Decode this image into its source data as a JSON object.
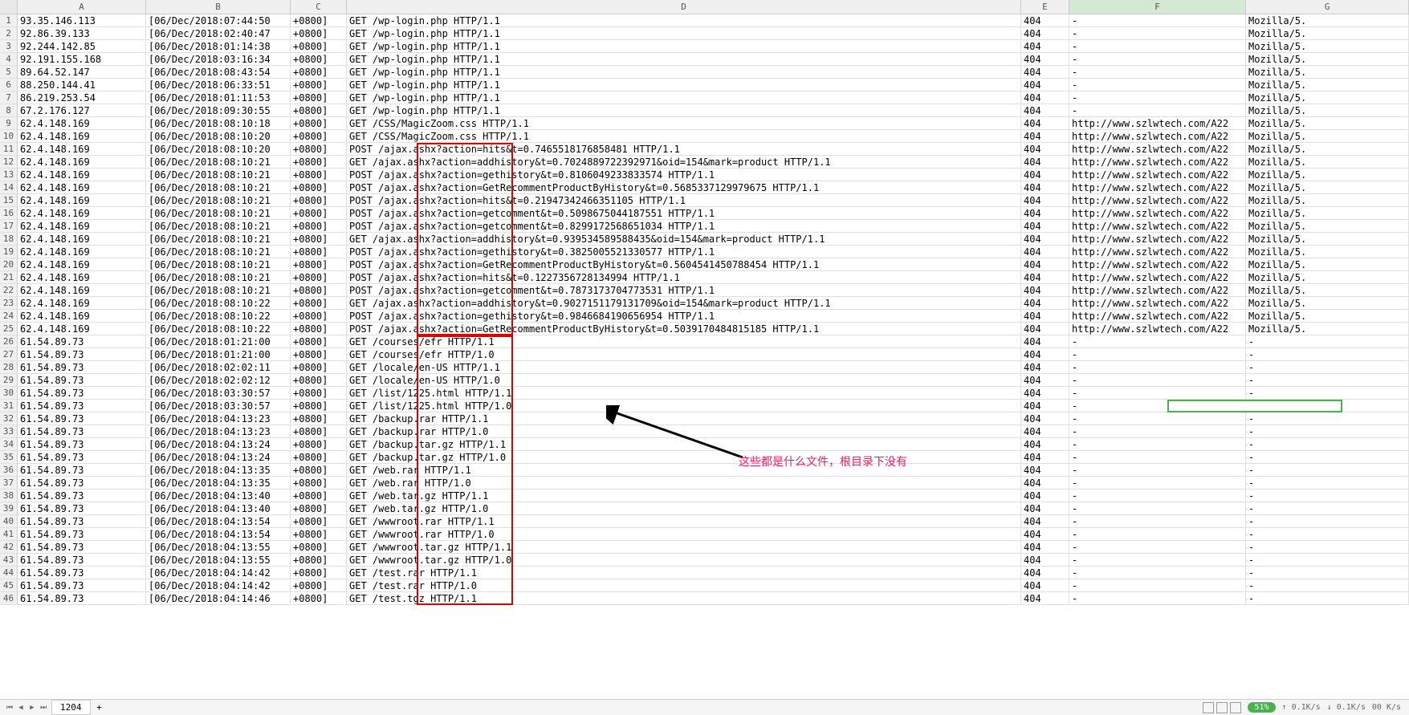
{
  "columns": [
    "A",
    "B",
    "C",
    "D",
    "E",
    "F",
    "G"
  ],
  "active_cell": {
    "row": 31,
    "col": "F"
  },
  "annotation_text": "这些都是什么文件，根目录下没有",
  "sheet_tab": "1204",
  "zoom": "51%",
  "net_up": "0.1K/s",
  "net_down": "0.1K/s",
  "net_total": "00 K/s",
  "rows": [
    {
      "n": 1,
      "A": "93.35.146.113",
      "B": "[06/Dec/2018:07:44:50",
      "C": "+0800]",
      "D": "GET /wp-login.php HTTP/1.1",
      "E": "404",
      "F": "-",
      "G": "Mozilla/5."
    },
    {
      "n": 2,
      "A": "92.86.39.133",
      "B": "[06/Dec/2018:02:40:47",
      "C": "+0800]",
      "D": "GET /wp-login.php HTTP/1.1",
      "E": "404",
      "F": "-",
      "G": "Mozilla/5."
    },
    {
      "n": 3,
      "A": "92.244.142.85",
      "B": "[06/Dec/2018:01:14:38",
      "C": "+0800]",
      "D": "GET /wp-login.php HTTP/1.1",
      "E": "404",
      "F": "-",
      "G": "Mozilla/5."
    },
    {
      "n": 4,
      "A": "92.191.155.168",
      "B": "[06/Dec/2018:03:16:34",
      "C": "+0800]",
      "D": "GET /wp-login.php HTTP/1.1",
      "E": "404",
      "F": "-",
      "G": "Mozilla/5."
    },
    {
      "n": 5,
      "A": "89.64.52.147",
      "B": "[06/Dec/2018:08:43:54",
      "C": "+0800]",
      "D": "GET /wp-login.php HTTP/1.1",
      "E": "404",
      "F": "-",
      "G": "Mozilla/5."
    },
    {
      "n": 6,
      "A": "88.250.144.41",
      "B": "[06/Dec/2018:06:33:51",
      "C": "+0800]",
      "D": "GET /wp-login.php HTTP/1.1",
      "E": "404",
      "F": "-",
      "G": "Mozilla/5."
    },
    {
      "n": 7,
      "A": "86.219.253.54",
      "B": "[06/Dec/2018:01:11:53",
      "C": "+0800]",
      "D": "GET /wp-login.php HTTP/1.1",
      "E": "404",
      "F": "-",
      "G": "Mozilla/5."
    },
    {
      "n": 8,
      "A": "67.2.176.127",
      "B": "[06/Dec/2018:09:30:55",
      "C": "+0800]",
      "D": "GET /wp-login.php HTTP/1.1",
      "E": "404",
      "F": "-",
      "G": "Mozilla/5."
    },
    {
      "n": 9,
      "A": "62.4.148.169",
      "B": "[06/Dec/2018:08:10:18",
      "C": "+0800]",
      "D": "GET /CSS/MagicZoom.css HTTP/1.1",
      "E": "404",
      "F": "http://www.szlwtech.com/A22",
      "G": "Mozilla/5."
    },
    {
      "n": 10,
      "A": "62.4.148.169",
      "B": "[06/Dec/2018:08:10:20",
      "C": "+0800]",
      "D": "GET /CSS/MagicZoom.css HTTP/1.1",
      "E": "404",
      "F": "http://www.szlwtech.com/A22",
      "G": "Mozilla/5."
    },
    {
      "n": 11,
      "A": "62.4.148.169",
      "B": "[06/Dec/2018:08:10:20",
      "C": "+0800]",
      "D": "POST /ajax.ashx?action=hits&t=0.7465518176858481 HTTP/1.1",
      "E": "404",
      "F": "http://www.szlwtech.com/A22",
      "G": "Mozilla/5."
    },
    {
      "n": 12,
      "A": "62.4.148.169",
      "B": "[06/Dec/2018:08:10:21",
      "C": "+0800]",
      "D": "GET /ajax.ashx?action=addhistory&t=0.7024889722392971&oid=154&mark=product HTTP/1.1",
      "E": "404",
      "F": "http://www.szlwtech.com/A22",
      "G": "Mozilla/5."
    },
    {
      "n": 13,
      "A": "62.4.148.169",
      "B": "[06/Dec/2018:08:10:21",
      "C": "+0800]",
      "D": "POST /ajax.ashx?action=gethistory&t=0.8106049233833574 HTTP/1.1",
      "E": "404",
      "F": "http://www.szlwtech.com/A22",
      "G": "Mozilla/5."
    },
    {
      "n": 14,
      "A": "62.4.148.169",
      "B": "[06/Dec/2018:08:10:21",
      "C": "+0800]",
      "D": "POST /ajax.ashx?action=GetRecommentProductByHistory&t=0.5685337129979675 HTTP/1.1",
      "E": "404",
      "F": "http://www.szlwtech.com/A22",
      "G": "Mozilla/5."
    },
    {
      "n": 15,
      "A": "62.4.148.169",
      "B": "[06/Dec/2018:08:10:21",
      "C": "+0800]",
      "D": "POST /ajax.ashx?action=hits&t=0.21947342466351105 HTTP/1.1",
      "E": "404",
      "F": "http://www.szlwtech.com/A22",
      "G": "Mozilla/5."
    },
    {
      "n": 16,
      "A": "62.4.148.169",
      "B": "[06/Dec/2018:08:10:21",
      "C": "+0800]",
      "D": "POST /ajax.ashx?action=getcomment&t=0.5098675044187551 HTTP/1.1",
      "E": "404",
      "F": "http://www.szlwtech.com/A22",
      "G": "Mozilla/5."
    },
    {
      "n": 17,
      "A": "62.4.148.169",
      "B": "[06/Dec/2018:08:10:21",
      "C": "+0800]",
      "D": "POST /ajax.ashx?action=getcomment&t=0.8299172568651034 HTTP/1.1",
      "E": "404",
      "F": "http://www.szlwtech.com/A22",
      "G": "Mozilla/5."
    },
    {
      "n": 18,
      "A": "62.4.148.169",
      "B": "[06/Dec/2018:08:10:21",
      "C": "+0800]",
      "D": "GET /ajax.ashx?action=addhistory&t=0.939534589588435&oid=154&mark=product HTTP/1.1",
      "E": "404",
      "F": "http://www.szlwtech.com/A22",
      "G": "Mozilla/5."
    },
    {
      "n": 19,
      "A": "62.4.148.169",
      "B": "[06/Dec/2018:08:10:21",
      "C": "+0800]",
      "D": "POST /ajax.ashx?action=gethistory&t=0.3825005521330577 HTTP/1.1",
      "E": "404",
      "F": "http://www.szlwtech.com/A22",
      "G": "Mozilla/5."
    },
    {
      "n": 20,
      "A": "62.4.148.169",
      "B": "[06/Dec/2018:08:10:21",
      "C": "+0800]",
      "D": "POST /ajax.ashx?action=GetRecommentProductByHistory&t=0.5604541450788454 HTTP/1.1",
      "E": "404",
      "F": "http://www.szlwtech.com/A22",
      "G": "Mozilla/5."
    },
    {
      "n": 21,
      "A": "62.4.148.169",
      "B": "[06/Dec/2018:08:10:21",
      "C": "+0800]",
      "D": "POST /ajax.ashx?action=hits&t=0.1227356728134994 HTTP/1.1",
      "E": "404",
      "F": "http://www.szlwtech.com/A22",
      "G": "Mozilla/5."
    },
    {
      "n": 22,
      "A": "62.4.148.169",
      "B": "[06/Dec/2018:08:10:21",
      "C": "+0800]",
      "D": "POST /ajax.ashx?action=getcomment&t=0.7873173704773531 HTTP/1.1",
      "E": "404",
      "F": "http://www.szlwtech.com/A22",
      "G": "Mozilla/5."
    },
    {
      "n": 23,
      "A": "62.4.148.169",
      "B": "[06/Dec/2018:08:10:22",
      "C": "+0800]",
      "D": "GET /ajax.ashx?action=addhistory&t=0.9027151179131709&oid=154&mark=product HTTP/1.1",
      "E": "404",
      "F": "http://www.szlwtech.com/A22",
      "G": "Mozilla/5."
    },
    {
      "n": 24,
      "A": "62.4.148.169",
      "B": "[06/Dec/2018:08:10:22",
      "C": "+0800]",
      "D": "POST /ajax.ashx?action=gethistory&t=0.9846684190656954 HTTP/1.1",
      "E": "404",
      "F": "http://www.szlwtech.com/A22",
      "G": "Mozilla/5."
    },
    {
      "n": 25,
      "A": "62.4.148.169",
      "B": "[06/Dec/2018:08:10:22",
      "C": "+0800]",
      "D": "POST /ajax.ashx?action=GetRecommentProductByHistory&t=0.5039170484815185 HTTP/1.1",
      "E": "404",
      "F": "http://www.szlwtech.com/A22",
      "G": "Mozilla/5."
    },
    {
      "n": 26,
      "A": "61.54.89.73",
      "B": "[06/Dec/2018:01:21:00",
      "C": "+0800]",
      "D": "GET /courses/efr HTTP/1.1",
      "E": "404",
      "F": "-",
      "G": "-"
    },
    {
      "n": 27,
      "A": "61.54.89.73",
      "B": "[06/Dec/2018:01:21:00",
      "C": "+0800]",
      "D": "GET /courses/efr HTTP/1.0",
      "E": "404",
      "F": "-",
      "G": "-"
    },
    {
      "n": 28,
      "A": "61.54.89.73",
      "B": "[06/Dec/2018:02:02:11",
      "C": "+0800]",
      "D": "GET /locale/en-US HTTP/1.1",
      "E": "404",
      "F": "-",
      "G": "-"
    },
    {
      "n": 29,
      "A": "61.54.89.73",
      "B": "[06/Dec/2018:02:02:12",
      "C": "+0800]",
      "D": "GET /locale/en-US HTTP/1.0",
      "E": "404",
      "F": "-",
      "G": "-"
    },
    {
      "n": 30,
      "A": "61.54.89.73",
      "B": "[06/Dec/2018:03:30:57",
      "C": "+0800]",
      "D": "GET /list/1225.html HTTP/1.1",
      "E": "404",
      "F": "-",
      "G": "-"
    },
    {
      "n": 31,
      "A": "61.54.89.73",
      "B": "[06/Dec/2018:03:30:57",
      "C": "+0800]",
      "D": "GET /list/1225.html HTTP/1.0",
      "E": "404",
      "F": "-",
      "G": "-"
    },
    {
      "n": 32,
      "A": "61.54.89.73",
      "B": "[06/Dec/2018:04:13:23",
      "C": "+0800]",
      "D": "GET /backup.rar HTTP/1.1",
      "E": "404",
      "F": "-",
      "G": "-"
    },
    {
      "n": 33,
      "A": "61.54.89.73",
      "B": "[06/Dec/2018:04:13:23",
      "C": "+0800]",
      "D": "GET /backup.rar HTTP/1.0",
      "E": "404",
      "F": "-",
      "G": "-"
    },
    {
      "n": 34,
      "A": "61.54.89.73",
      "B": "[06/Dec/2018:04:13:24",
      "C": "+0800]",
      "D": "GET /backup.tar.gz HTTP/1.1",
      "E": "404",
      "F": "-",
      "G": "-"
    },
    {
      "n": 35,
      "A": "61.54.89.73",
      "B": "[06/Dec/2018:04:13:24",
      "C": "+0800]",
      "D": "GET /backup.tar.gz HTTP/1.0",
      "E": "404",
      "F": "-",
      "G": "-"
    },
    {
      "n": 36,
      "A": "61.54.89.73",
      "B": "[06/Dec/2018:04:13:35",
      "C": "+0800]",
      "D": "GET /web.rar HTTP/1.1",
      "E": "404",
      "F": "-",
      "G": "-"
    },
    {
      "n": 37,
      "A": "61.54.89.73",
      "B": "[06/Dec/2018:04:13:35",
      "C": "+0800]",
      "D": "GET /web.rar HTTP/1.0",
      "E": "404",
      "F": "-",
      "G": "-"
    },
    {
      "n": 38,
      "A": "61.54.89.73",
      "B": "[06/Dec/2018:04:13:40",
      "C": "+0800]",
      "D": "GET /web.tar.gz HTTP/1.1",
      "E": "404",
      "F": "-",
      "G": "-"
    },
    {
      "n": 39,
      "A": "61.54.89.73",
      "B": "[06/Dec/2018:04:13:40",
      "C": "+0800]",
      "D": "GET /web.tar.gz HTTP/1.0",
      "E": "404",
      "F": "-",
      "G": "-"
    },
    {
      "n": 40,
      "A": "61.54.89.73",
      "B": "[06/Dec/2018:04:13:54",
      "C": "+0800]",
      "D": "GET /wwwroot.rar HTTP/1.1",
      "E": "404",
      "F": "-",
      "G": "-"
    },
    {
      "n": 41,
      "A": "61.54.89.73",
      "B": "[06/Dec/2018:04:13:54",
      "C": "+0800]",
      "D": "GET /wwwroot.rar HTTP/1.0",
      "E": "404",
      "F": "-",
      "G": "-"
    },
    {
      "n": 42,
      "A": "61.54.89.73",
      "B": "[06/Dec/2018:04:13:55",
      "C": "+0800]",
      "D": "GET /wwwroot.tar.gz HTTP/1.1",
      "E": "404",
      "F": "-",
      "G": "-"
    },
    {
      "n": 43,
      "A": "61.54.89.73",
      "B": "[06/Dec/2018:04:13:55",
      "C": "+0800]",
      "D": "GET /wwwroot.tar.gz HTTP/1.0",
      "E": "404",
      "F": "-",
      "G": "-"
    },
    {
      "n": 44,
      "A": "61.54.89.73",
      "B": "[06/Dec/2018:04:14:42",
      "C": "+0800]",
      "D": "GET /test.rar HTTP/1.1",
      "E": "404",
      "F": "-",
      "G": "-"
    },
    {
      "n": 45,
      "A": "61.54.89.73",
      "B": "[06/Dec/2018:04:14:42",
      "C": "+0800]",
      "D": "GET /test.rar HTTP/1.0",
      "E": "404",
      "F": "-",
      "G": "-"
    },
    {
      "n": 46,
      "A": "61.54.89.73",
      "B": "[06/Dec/2018:04:14:46",
      "C": "+0800]",
      "D": "GET /test.tgz HTTP/1.1",
      "E": "404",
      "F": "-",
      "G": "-"
    }
  ]
}
